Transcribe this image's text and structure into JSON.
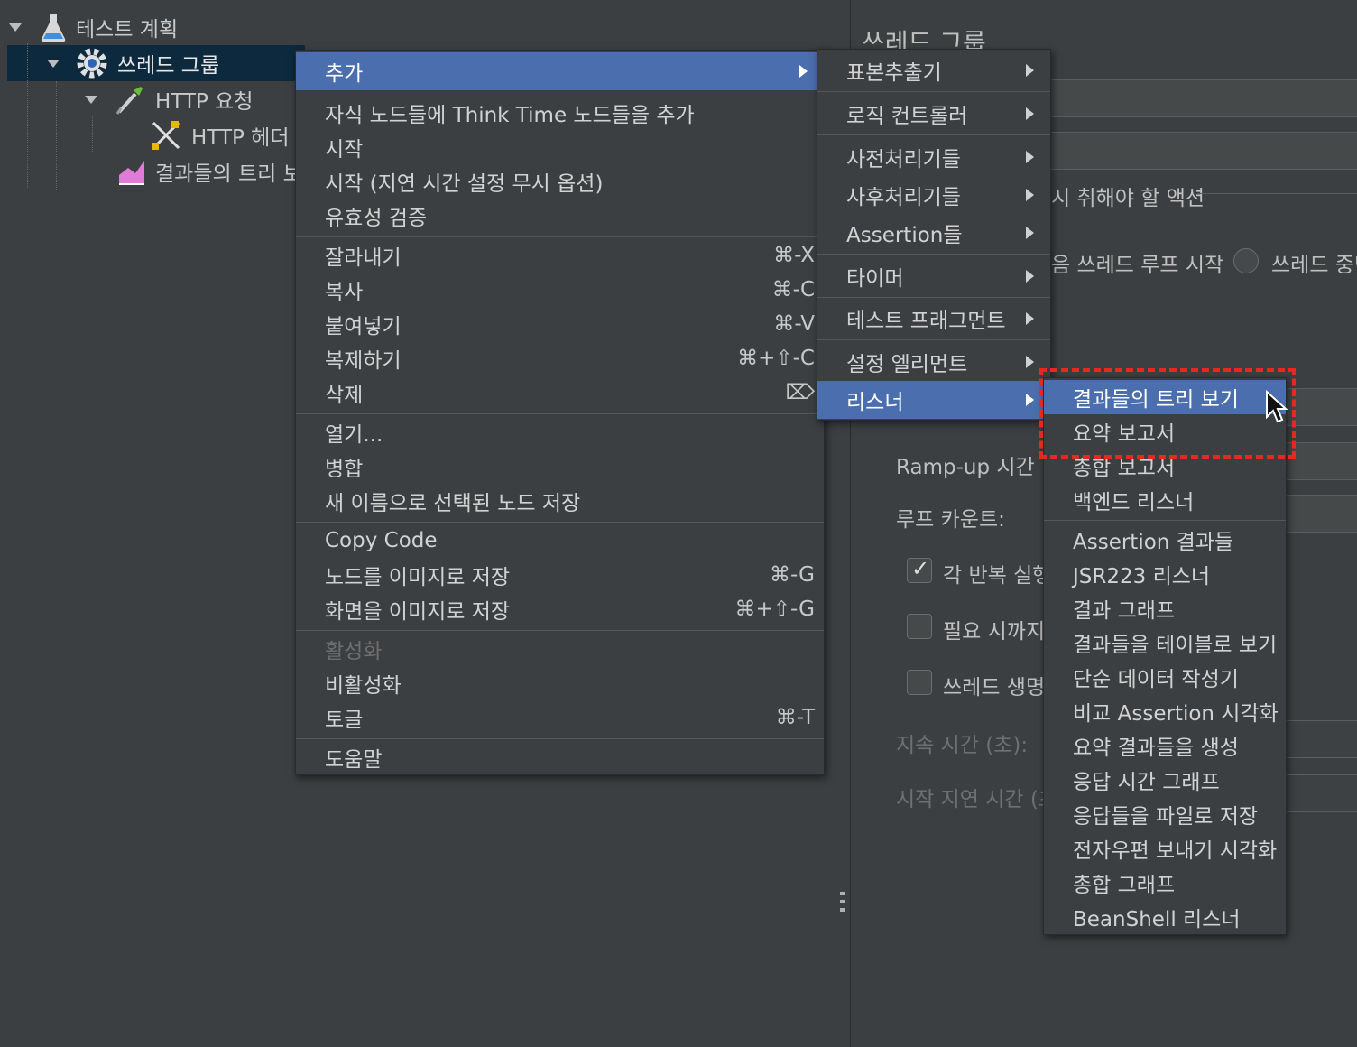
{
  "tree": {
    "nodes": [
      {
        "label": "테스트 계획",
        "icon": "flask-icon"
      },
      {
        "label": "쓰레드 그룹",
        "icon": "gear-icon"
      },
      {
        "label": "HTTP 요청",
        "icon": "pipette-icon"
      },
      {
        "label": "HTTP 헤더",
        "icon": "tools-icon"
      },
      {
        "label": "결과들의 트리 보",
        "icon": "graph-icon"
      }
    ]
  },
  "right_panel": {
    "title": "쓰레드 그룹",
    "action_label": "시 취해야 할 액션",
    "radio_next_loop": "음 쓰레드 루프 시작",
    "radio_stop_thread": "쓰레드 중단",
    "rampup_label": "Ramp-up 시간 (",
    "loop_count_label": "루프 카운트:",
    "each_iteration_label": "각 반복 실행",
    "until_needed_label": "필요 시까지",
    "thread_lifetime_label": "쓰레드 생명",
    "duration_label": "지속 시간 (초):",
    "startup_delay_label": "시작 지연 시간 (초"
  },
  "context_menu": {
    "items": [
      {
        "label": "추가",
        "submenu": true,
        "selected": true
      },
      {
        "label": "자식 노드들에 Think Time 노드들을 추가"
      },
      {
        "label": "시작"
      },
      {
        "label": "시작 (지연 시간 설정 무시 옵션)"
      },
      {
        "label": "유효성 검증"
      },
      {
        "label": "잘라내기",
        "shortcut": "⌘-X"
      },
      {
        "label": "복사",
        "shortcut": "⌘-C"
      },
      {
        "label": "붙여넣기",
        "shortcut": "⌘-V"
      },
      {
        "label": "복제하기",
        "shortcut": "⌘+⇧-C"
      },
      {
        "label": "삭제",
        "shortcut": "⌦"
      },
      {
        "label": "열기..."
      },
      {
        "label": "병합"
      },
      {
        "label": "새 이름으로 선택된 노드 저장"
      },
      {
        "label": "Copy Code"
      },
      {
        "label": "노드를 이미지로 저장",
        "shortcut": "⌘-G"
      },
      {
        "label": "화면을 이미지로 저장",
        "shortcut": "⌘+⇧-G"
      },
      {
        "label": "활성화",
        "disabled": true
      },
      {
        "label": "비활성화"
      },
      {
        "label": "토글",
        "shortcut": "⌘-T"
      },
      {
        "label": "도움말"
      }
    ]
  },
  "add_submenu": {
    "items": [
      {
        "label": "표본추출기"
      },
      {
        "label": "로직 컨트롤러"
      },
      {
        "label": "사전처리기들"
      },
      {
        "label": "사후처리기들"
      },
      {
        "label": "Assertion들"
      },
      {
        "label": "타이머"
      },
      {
        "label": "테스트 프래그먼트"
      },
      {
        "label": "설정 엘리먼트"
      },
      {
        "label": "리스너",
        "selected": true
      }
    ]
  },
  "listener_submenu": {
    "items": [
      {
        "label": "결과들의 트리 보기",
        "selected": true
      },
      {
        "label": "요약 보고서"
      },
      {
        "label": "총합 보고서"
      },
      {
        "label": "백엔드 리스너"
      },
      {
        "label": "Assertion 결과들"
      },
      {
        "label": "JSR223 리스너"
      },
      {
        "label": "결과 그래프"
      },
      {
        "label": "결과들을 테이블로 보기"
      },
      {
        "label": "단순 데이터 작성기"
      },
      {
        "label": "비교 Assertion 시각화"
      },
      {
        "label": "요약 결과들을 생성"
      },
      {
        "label": "응답 시간 그래프"
      },
      {
        "label": "응답들을 파일로 저장"
      },
      {
        "label": "전자우편 보내기 시각화"
      },
      {
        "label": "총합 그래프"
      },
      {
        "label": "BeanShell 리스너"
      }
    ]
  },
  "colors": {
    "background": "#3c3f41",
    "selection": "#4b6eaf",
    "tree_selection": "#0d293e",
    "highlight_box": "#e8271f"
  }
}
